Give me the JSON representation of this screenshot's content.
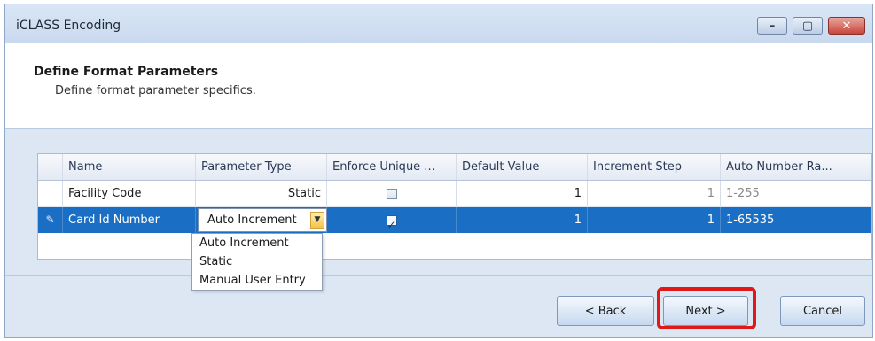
{
  "window": {
    "title": "iCLASS Encoding",
    "controls": {
      "minimize": "–",
      "maximize": "▢",
      "close": "✕"
    }
  },
  "header": {
    "title": "Define Format Parameters",
    "subtitle": "Define format parameter specifics."
  },
  "grid": {
    "columns": [
      "Name",
      "Parameter Type",
      "Enforce Unique ...",
      "Default Value",
      "Increment Step",
      "Auto Number Ra..."
    ],
    "rows": [
      {
        "name": "Facility Code",
        "parameter_type": "Static",
        "enforce_unique": false,
        "default_value": "1",
        "increment_step": "1",
        "auto_number_range": "1-255"
      },
      {
        "name": "Card Id Number",
        "parameter_type": "Auto Increment",
        "enforce_unique": true,
        "default_value": "1",
        "increment_step": "1",
        "auto_number_range": "1-65535",
        "row_icon": "pencil-icon"
      }
    ]
  },
  "dropdown": {
    "options": [
      "Auto Increment",
      "Static",
      "Manual User Entry"
    ]
  },
  "buttons": {
    "back": "< Back",
    "next": "Next >",
    "cancel": "Cancel"
  },
  "colors": {
    "selection": "#1a6fc4",
    "highlight": "#e01818"
  }
}
